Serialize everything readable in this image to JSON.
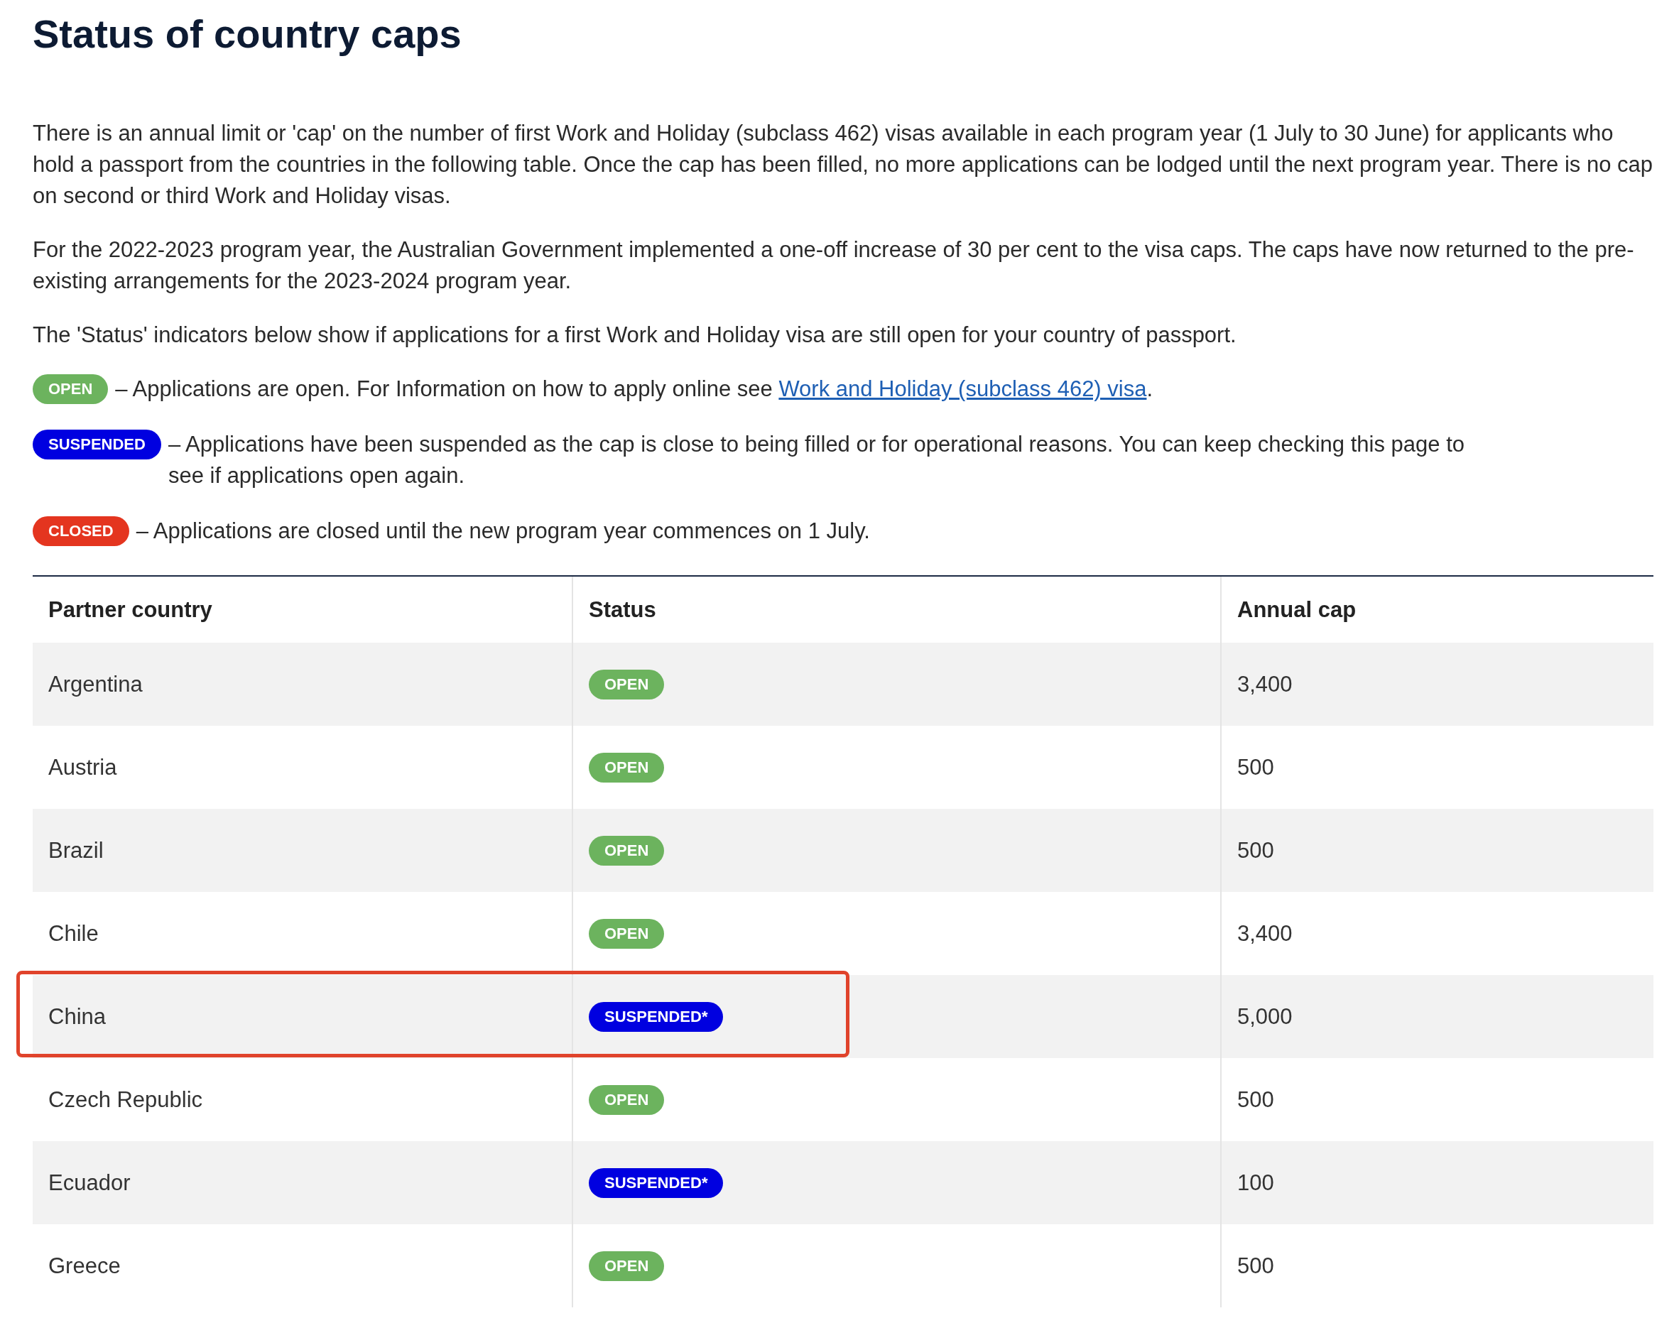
{
  "title": "Status of country caps",
  "paragraphs": [
    "There is an annual limit or 'cap' on the number of first Work and Holiday (subclass 462) visas available in each program year (1 July to 30 June) for applicants who hold a passport from the countries in the following table. Once the cap has been filled, no more applications can be lodged until the next program year. There is no cap on second or third Work and Holiday visas.",
    "For the 2022-2023 program year, the Australian Government implemented a one-off increase of 30 per cent to the visa caps. The caps have now returned to the pre-existing arrangements for the 2023-2024 program year.",
    "The 'Status' indicators below show if applications for a first Work and Holiday visa are still open for your country of passport."
  ],
  "legend": [
    {
      "kind": "open",
      "badge": "OPEN",
      "text": "– Applications are open.  For Information on how to apply online see ",
      "link": "Work and Holiday (subclass 462) visa",
      "after": "."
    },
    {
      "kind": "suspended",
      "badge": "SUSPENDED",
      "text": "– Applications have been suspended as the cap is close to being filled or for operational reasons. You can keep checking this page to see if applications open again."
    },
    {
      "kind": "closed",
      "badge": "CLOSED",
      "text": "– Applications are closed until the new program year commences on 1 July."
    }
  ],
  "table": {
    "columns": [
      "Partner country",
      "Status",
      "Annual cap"
    ],
    "rows": [
      {
        "country": "Argentina",
        "status": {
          "kind": "open",
          "label": "OPEN"
        },
        "cap": "3,400",
        "highlighted": false
      },
      {
        "country": "Austria",
        "status": {
          "kind": "open",
          "label": "OPEN"
        },
        "cap": "500",
        "highlighted": false
      },
      {
        "country": "Brazil",
        "status": {
          "kind": "open",
          "label": "OPEN"
        },
        "cap": "500",
        "highlighted": false
      },
      {
        "country": "Chile",
        "status": {
          "kind": "open",
          "label": "OPEN"
        },
        "cap": "3,400",
        "highlighted": false
      },
      {
        "country": "China",
        "status": {
          "kind": "suspended",
          "label": "SUSPENDED*"
        },
        "cap": "5,000",
        "highlighted": true
      },
      {
        "country": "Czech Republic",
        "status": {
          "kind": "open",
          "label": "OPEN"
        },
        "cap": "500",
        "highlighted": false
      },
      {
        "country": "Ecuador",
        "status": {
          "kind": "suspended",
          "label": "SUSPENDED*"
        },
        "cap": "100",
        "highlighted": false
      },
      {
        "country": "Greece",
        "status": {
          "kind": "open",
          "label": "OPEN"
        },
        "cap": "500",
        "highlighted": false
      }
    ]
  }
}
